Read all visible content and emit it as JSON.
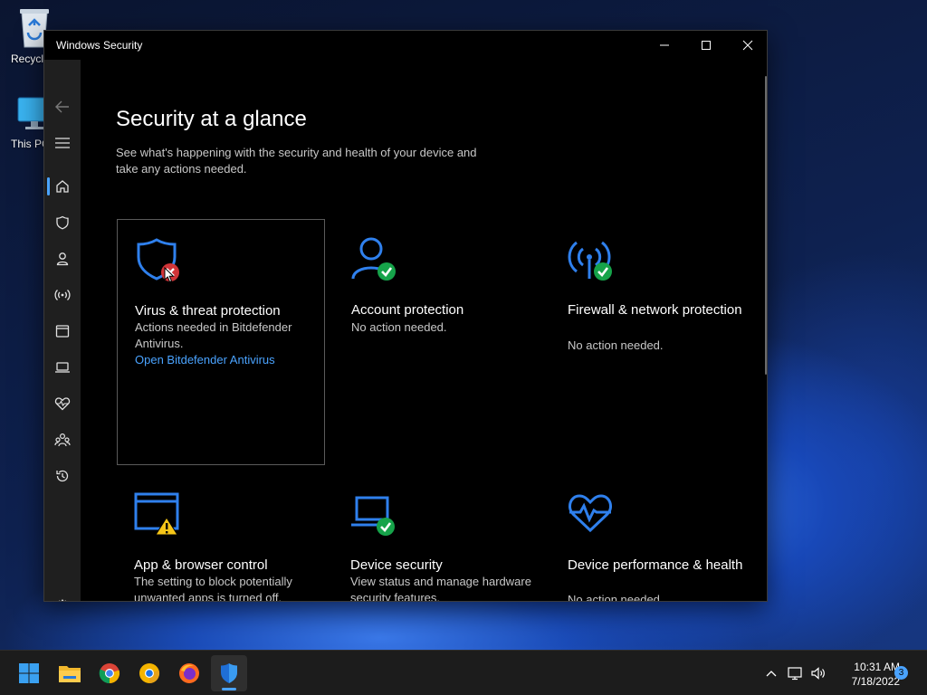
{
  "desktop": {
    "icons": [
      {
        "label": "Recycle Bin",
        "icon": "recycle-bin-icon"
      },
      {
        "label": "This PC",
        "icon": "this-pc-icon"
      }
    ]
  },
  "window": {
    "title": "Windows Security",
    "controls": {
      "minimize": "minimize-icon",
      "maximize": "maximize-icon",
      "close": "close-icon"
    }
  },
  "nav": {
    "items": [
      {
        "name": "back",
        "icon": "back-arrow-icon"
      },
      {
        "name": "menu",
        "icon": "hamburger-menu-icon"
      },
      {
        "name": "home",
        "icon": "home-icon",
        "active": true
      },
      {
        "name": "virus-threat",
        "icon": "shield-icon"
      },
      {
        "name": "account",
        "icon": "person-icon"
      },
      {
        "name": "firewall",
        "icon": "antenna-icon"
      },
      {
        "name": "app-browser",
        "icon": "app-window-icon"
      },
      {
        "name": "device-security",
        "icon": "laptop-icon"
      },
      {
        "name": "device-performance",
        "icon": "heart-pulse-icon"
      },
      {
        "name": "family",
        "icon": "family-icon"
      },
      {
        "name": "history",
        "icon": "history-icon"
      },
      {
        "name": "settings",
        "icon": "gear-icon"
      }
    ]
  },
  "main": {
    "title": "Security at a glance",
    "subtitle": "See what's happening with the security and health of your device and take any actions needed.",
    "tiles": [
      {
        "title": "Virus & threat protection",
        "desc": "Actions needed in Bitdefender Antivirus.",
        "link": "Open Bitdefender Antivirus",
        "icon": "shield-icon",
        "status": "error"
      },
      {
        "title": "Account protection",
        "desc": "No action needed.",
        "icon": "person-icon",
        "status": "ok"
      },
      {
        "title": "Firewall & network protection",
        "desc": "No action needed.",
        "icon": "antenna-icon",
        "status": "ok"
      },
      {
        "title": "App & browser control",
        "desc": "The setting to block potentially unwanted apps is turned off.",
        "icon": "app-window-icon",
        "status": "warning"
      },
      {
        "title": "Device security",
        "desc": "View status and manage hardware security features.",
        "icon": "laptop-icon",
        "status": "ok"
      },
      {
        "title": "Device performance & health",
        "desc": "No action needed.",
        "icon": "heart-pulse-icon",
        "status": "none"
      }
    ]
  },
  "taskbar": {
    "apps": [
      {
        "name": "start",
        "icon": "windows-start-icon"
      },
      {
        "name": "file-explorer",
        "icon": "folder-icon"
      },
      {
        "name": "chrome",
        "icon": "chrome-icon"
      },
      {
        "name": "chrome-canary",
        "icon": "chrome-canary-icon"
      },
      {
        "name": "firefox",
        "icon": "firefox-icon"
      },
      {
        "name": "windows-security",
        "icon": "shield-icon",
        "active": true
      }
    ],
    "tray": {
      "time": "10:31 AM",
      "date": "7/18/2022",
      "notifications": "3"
    }
  },
  "colors": {
    "accent": "#4aa3ff",
    "ok": "#16a34a",
    "error": "#d13438",
    "warning": "#f5c518",
    "icon_blue": "#2f80ed"
  }
}
